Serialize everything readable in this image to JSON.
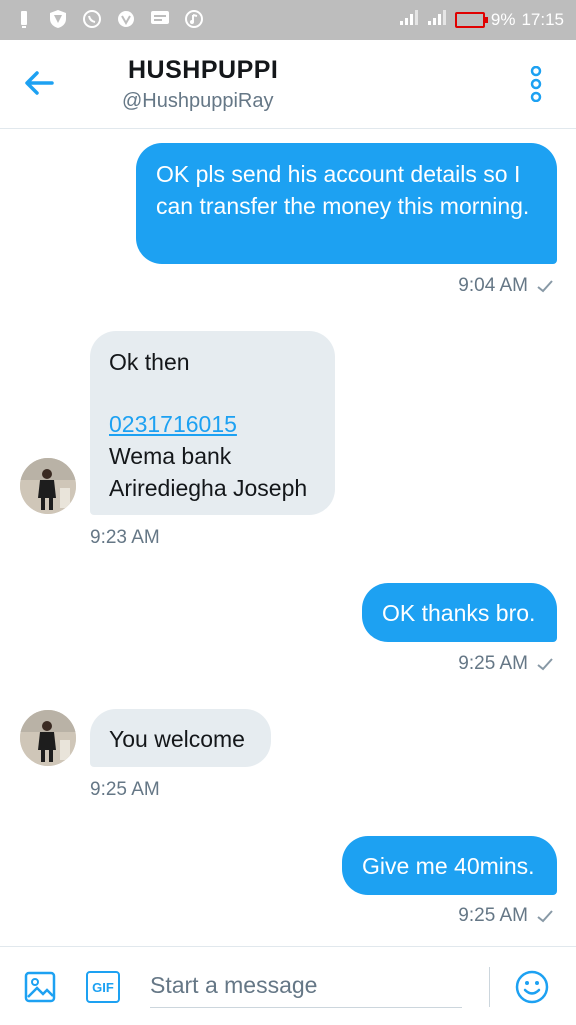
{
  "status_bar": {
    "battery": "9%",
    "time": "17:15"
  },
  "header": {
    "name": "HUSHPUPPI",
    "handle": "@HushpuppiRay"
  },
  "messages": [
    {
      "dir": "out",
      "text": "OK pls send his account details so I can transfer the money this morning.",
      "time": "9:04 AM"
    },
    {
      "dir": "in",
      "line1": "Ok then",
      "account": "0231716015",
      "bank": "Wema bank",
      "account_name": "Arirediegha Joseph",
      "time": "9:23 AM"
    },
    {
      "dir": "out",
      "text": "OK thanks bro.",
      "time": "9:25 AM"
    },
    {
      "dir": "in",
      "text": "You welcome",
      "time": "9:25 AM"
    },
    {
      "dir": "out",
      "text": "Give me 40mins.",
      "time": "9:25 AM"
    }
  ],
  "composer": {
    "gif_label": "GIF",
    "placeholder": "Start a message"
  },
  "colors": {
    "accent": "#1da1f2",
    "in_bubble": "#e6ecf0",
    "muted": "#657786"
  }
}
